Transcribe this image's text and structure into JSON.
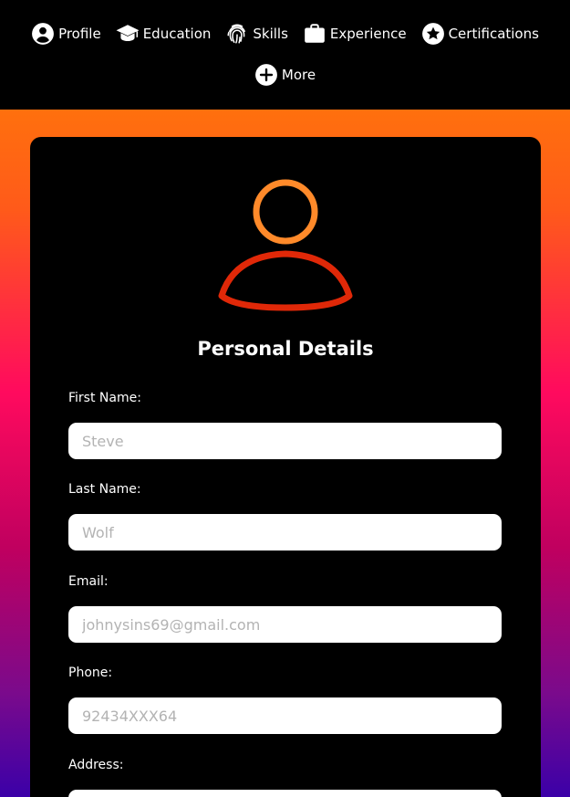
{
  "nav": {
    "items": [
      {
        "label": "Profile",
        "icon": "user-circle-icon"
      },
      {
        "label": "Education",
        "icon": "graduation-cap-icon"
      },
      {
        "label": "Skills",
        "icon": "fingerprint-icon"
      },
      {
        "label": "Experience",
        "icon": "briefcase-icon"
      },
      {
        "label": "Certifications",
        "icon": "star-circle-icon"
      },
      {
        "label": "More",
        "icon": "plus-circle-icon"
      }
    ]
  },
  "card": {
    "avatar_icon": "user-outline-icon",
    "title": "Personal Details",
    "fields": [
      {
        "label": "First Name:",
        "placeholder": "Steve",
        "value": ""
      },
      {
        "label": "Last Name:",
        "placeholder": "Wolf",
        "value": ""
      },
      {
        "label": "Email:",
        "placeholder": "johnysins69@gmail.com",
        "value": ""
      },
      {
        "label": "Phone:",
        "placeholder": "92434XXX64",
        "value": ""
      },
      {
        "label": "Address:",
        "placeholder": "",
        "value": ""
      }
    ]
  },
  "colors": {
    "nav_bg": "#000000",
    "card_bg": "#000000",
    "gradient_top": "#ff8800",
    "gradient_mid": "#ff0a5e",
    "gradient_bottom": "#3b00a8",
    "avatar_head": "#ff8a2a",
    "avatar_body": "#e02808"
  }
}
